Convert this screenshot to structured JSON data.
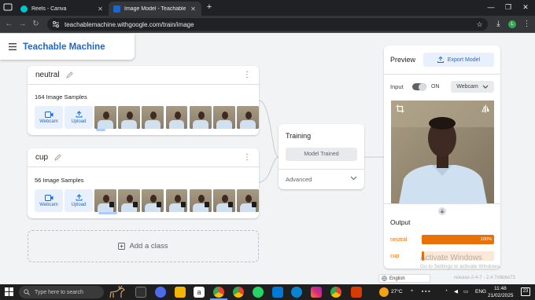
{
  "browser": {
    "tabs": [
      {
        "title": "Reels - Canva",
        "active": false,
        "favicon_color": "#00c4cc"
      },
      {
        "title": "Image Model - Teachable M",
        "active": true,
        "favicon_color": "#1967d2"
      }
    ],
    "new_tab_symbol": "+",
    "url": "teachablemachine.withgoogle.com/train/image",
    "window_controls": [
      "minimize-icon",
      "maximize-icon",
      "close-icon"
    ]
  },
  "app": {
    "brand": "Teachable Machine",
    "classes": [
      {
        "name": "neutral",
        "samples_label": "164 Image Samples",
        "webcam_label": "Webcam",
        "upload_label": "Upload",
        "thumb_count": 7,
        "with_cup": false
      },
      {
        "name": "cup",
        "samples_label": "56 Image Samples",
        "webcam_label": "Webcam",
        "upload_label": "Upload",
        "thumb_count": 7,
        "with_cup": true
      }
    ],
    "add_class_label": "Add a class",
    "training": {
      "title": "Training",
      "button_label": "Model Trained",
      "advanced_label": "Advanced"
    },
    "preview": {
      "title": "Preview",
      "export_label": "Export Model",
      "input_label": "Input",
      "toggle_state": "ON",
      "source_select": "Webcam",
      "output_title": "Output",
      "outputs": [
        {
          "label": "neutral",
          "value": 1.0,
          "display": "100%"
        },
        {
          "label": "cup",
          "value": 0.0,
          "display": ""
        }
      ]
    },
    "watermark": {
      "title": "Activate Windows",
      "subtitle": "Go to Settings to activate Windows."
    },
    "language_select": "English",
    "version_text": "release-2-4-7 - 2.4.7#6b6e73"
  },
  "taskbar": {
    "search_placeholder": "Type here to search",
    "weather": "27°C",
    "language": "ENG",
    "time": "11:48",
    "date": "21/02/2025",
    "notification_count": "23"
  },
  "colors": {
    "accent": "#1967d2",
    "output": "#e8710a",
    "light_blue": "#e8f0fe"
  }
}
